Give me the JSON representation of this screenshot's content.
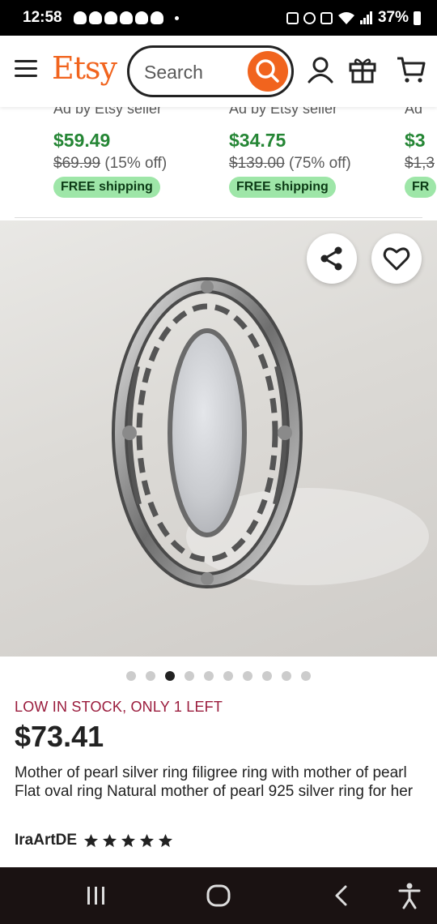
{
  "status_bar": {
    "time": "12:58",
    "battery": "37%"
  },
  "header": {
    "logo": "Etsy",
    "search_placeholder": "Search",
    "icons": [
      "menu-icon",
      "search-icon",
      "user-icon",
      "gift-icon",
      "cart-icon"
    ]
  },
  "listings": [
    {
      "ad": "Ad by Etsy seller",
      "price": "$59.49",
      "original": "$69.99",
      "discount": "(15% off)",
      "shipping": "FREE shipping"
    },
    {
      "ad": "Ad by Etsy seller",
      "price": "$34.75",
      "original": "$139.00",
      "discount": "(75% off)",
      "shipping": "FREE shipping"
    },
    {
      "ad": "Ad",
      "price": "$3",
      "original": "$1,3",
      "discount": "",
      "shipping": "FR"
    }
  ],
  "product": {
    "image_alt_icons": [
      "share-icon",
      "heart-icon"
    ],
    "carousel": {
      "count": 10,
      "active_index": 2
    },
    "stock_notice": "LOW IN STOCK, ONLY 1 LEFT",
    "price": "$73.41",
    "title": "Mother of pearl silver ring filigree ring with mother of pearl Flat oval ring Natural mother of pearl 925 silver ring for her",
    "shop_name": "IraArtDE",
    "rating_stars": 5
  },
  "colors": {
    "brand": "#F1641E",
    "sale_price": "#258635",
    "free_shipping_bg": "#9EE6A8",
    "stock_notice": "#9a1b3c"
  }
}
